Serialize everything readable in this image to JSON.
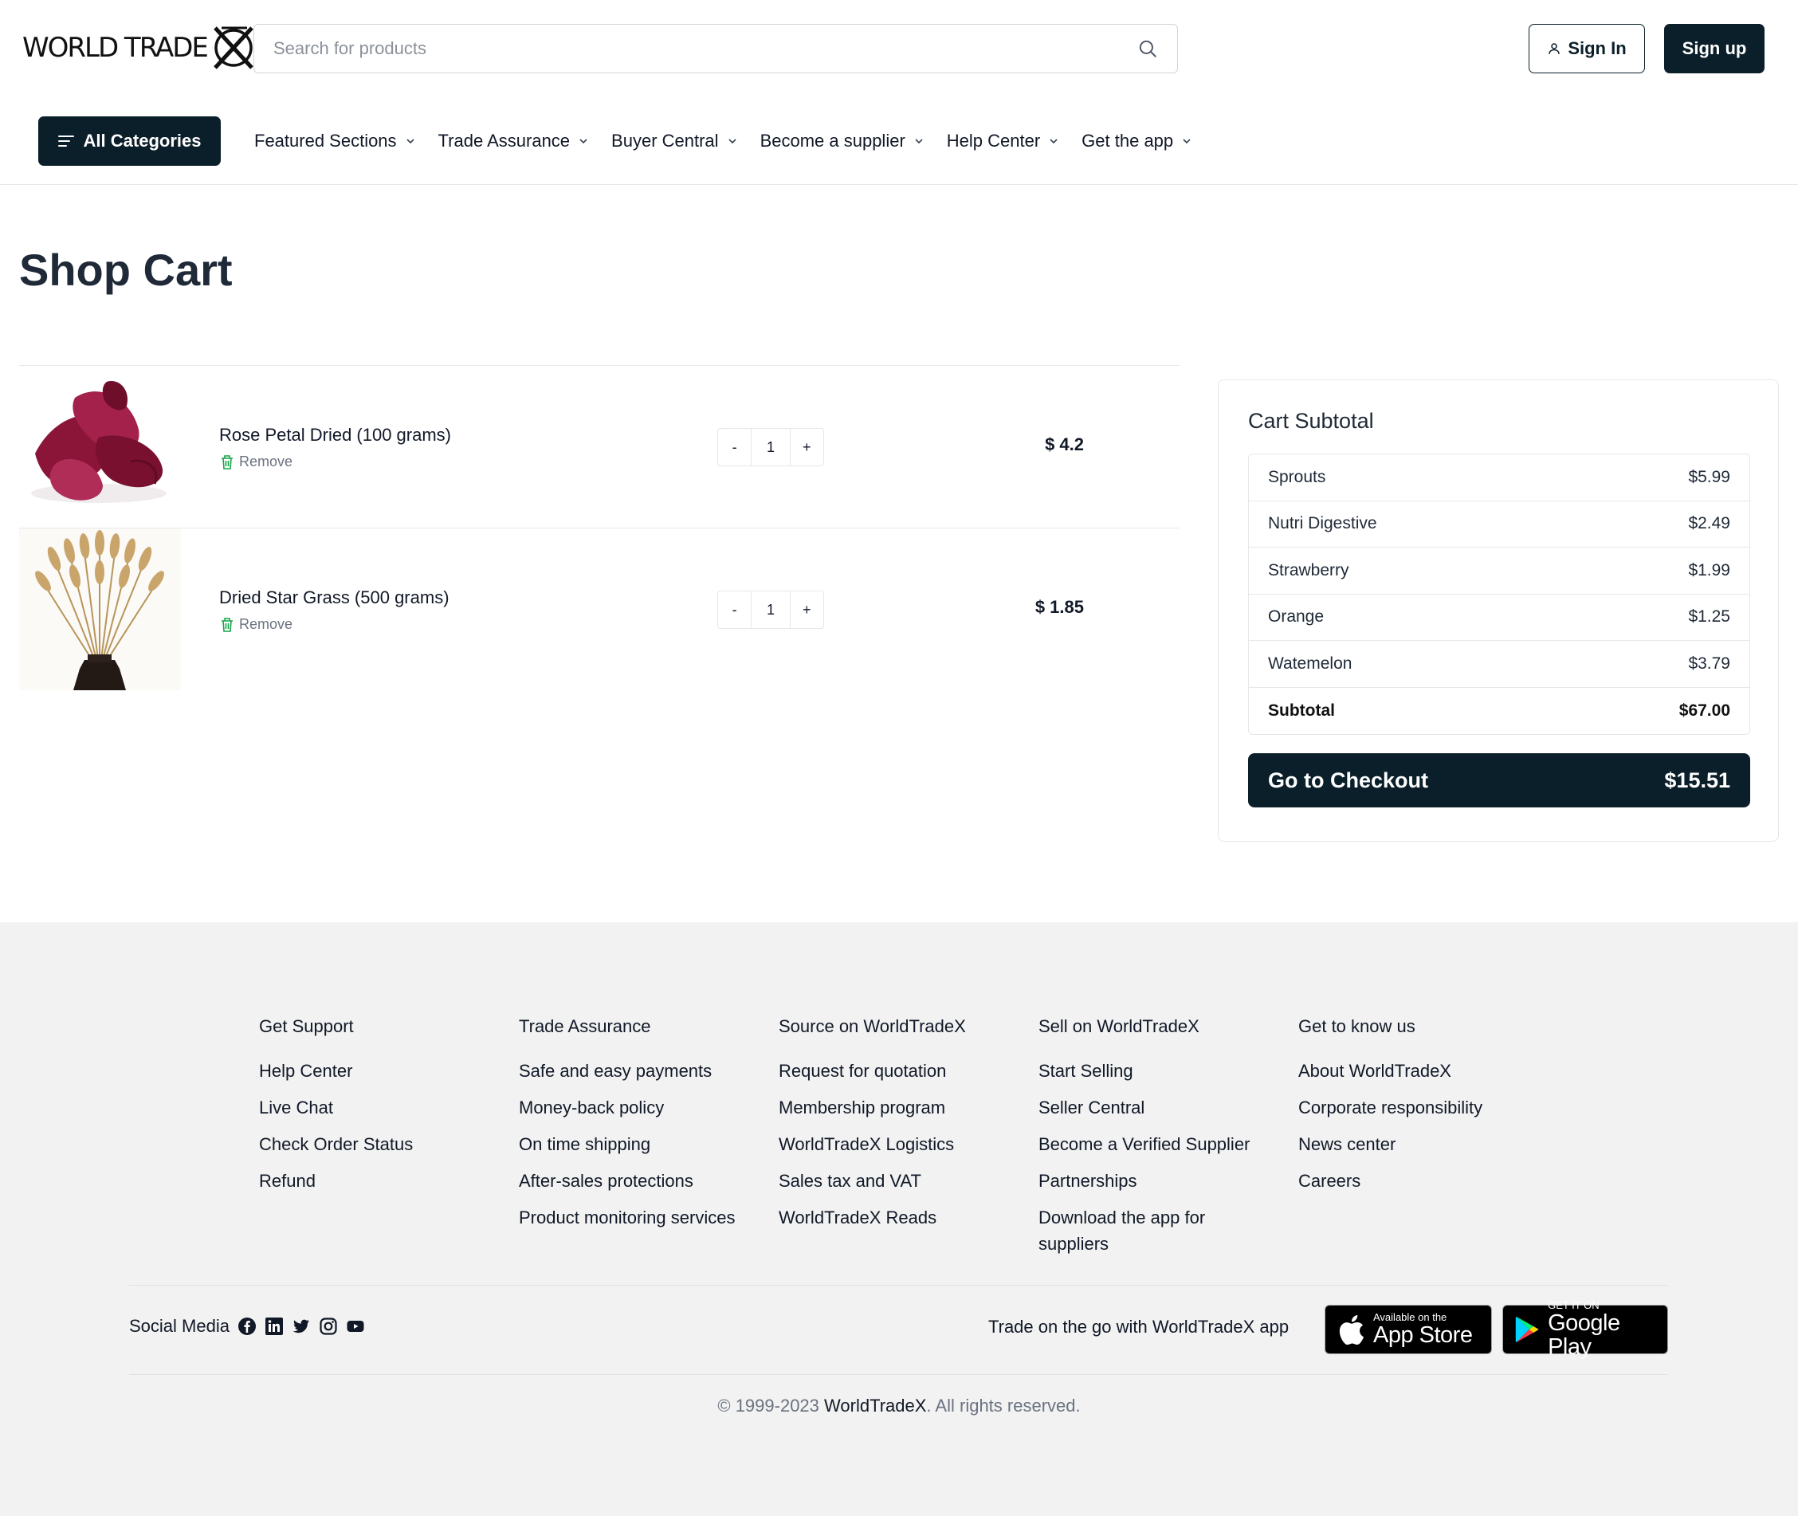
{
  "header": {
    "logo_text": "WORLD TRADE",
    "search_placeholder": "Search for products",
    "signin_label": "Sign In",
    "signup_label": "Sign up",
    "all_categories_label": "All Categories",
    "nav": [
      {
        "label": "Featured Sections"
      },
      {
        "label": "Trade Assurance"
      },
      {
        "label": "Buyer Central"
      },
      {
        "label": "Become a supplier"
      },
      {
        "label": "Help Center"
      },
      {
        "label": "Get the app"
      }
    ]
  },
  "page_title": "Shop Cart",
  "cart_items": [
    {
      "name": "Rose Petal Dried (100 grams)",
      "remove_label": "Remove",
      "qty_minus": "-",
      "qty": "1",
      "qty_plus": "+",
      "price": "$ 4.2"
    },
    {
      "name": "Dried Star Grass (500 grams)",
      "remove_label": "Remove",
      "qty_minus": "-",
      "qty": "1",
      "qty_plus": "+",
      "price": "$ 1.85"
    }
  ],
  "summary": {
    "title": "Cart Subtotal",
    "rows": [
      {
        "label": "Sprouts",
        "value": "$5.99"
      },
      {
        "label": "Nutri Digestive",
        "value": "$2.49"
      },
      {
        "label": "Strawberry",
        "value": "$1.99"
      },
      {
        "label": "Orange",
        "value": "$1.25"
      },
      {
        "label": "Watemelon",
        "value": "$3.79"
      },
      {
        "label": "Subtotal",
        "value": "$67.00"
      }
    ],
    "checkout_label": "Go to Checkout",
    "checkout_total": "$15.51"
  },
  "footer": {
    "columns": [
      {
        "title": "Get Support",
        "links": [
          "Help Center",
          "Live Chat",
          "Check Order Status",
          "Refund"
        ]
      },
      {
        "title": "Trade Assurance",
        "links": [
          "Safe and easy payments",
          "Money-back policy",
          "On time shipping",
          "After-sales protections",
          "Product monitoring services"
        ]
      },
      {
        "title": "Source on WorldTradeX",
        "links": [
          "Request for quotation",
          "Membership program",
          "WorldTradeX Logistics",
          "Sales tax and VAT",
          "WorldTradeX Reads"
        ]
      },
      {
        "title": "Sell on WorldTradeX",
        "links": [
          "Start Selling",
          "Seller Central",
          "Become a Verified Supplier",
          "Partnerships",
          "Download the app for suppliers"
        ]
      },
      {
        "title": "Get to know us",
        "links": [
          "About WorldTradeX",
          "Corporate responsibility",
          "News center",
          "Careers"
        ]
      }
    ],
    "social_label": "Social Media",
    "social_icons": [
      "facebook-icon",
      "linkedin-icon",
      "twitter-icon",
      "instagram-icon",
      "youtube-icon"
    ],
    "app_text": "Trade on the go with WorldTradeX app",
    "appstore_small": "Available on the",
    "appstore_big": "App Store",
    "googleplay_small": "GET IT ON",
    "googleplay_big": "Google Play",
    "copyright_prefix": "© 1999-2023 ",
    "copyright_brand": "WorldTradeX",
    "copyright_suffix": ". All rights reserved."
  },
  "colors": {
    "primary": "#0b1f2a",
    "footer_bg": "#f1f2f1",
    "remove_icon": "#16a34a"
  }
}
